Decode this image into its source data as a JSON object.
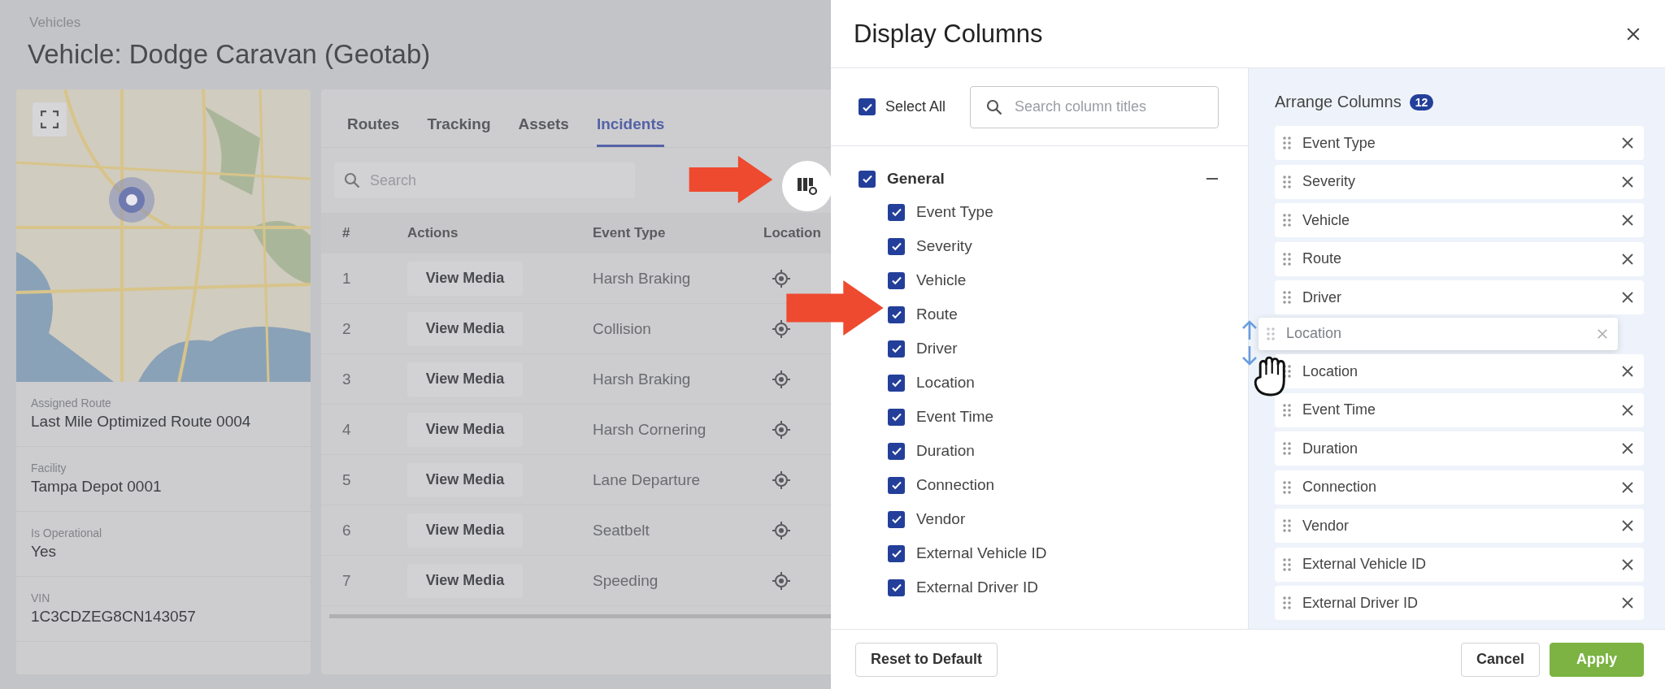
{
  "page": {
    "breadcrumb": "Vehicles",
    "title": "Vehicle: Dodge Caravan (Geotab)",
    "details": [
      {
        "label": "Assigned Route",
        "value": "Last Mile Optimized Route 0004"
      },
      {
        "label": "Facility",
        "value": "Tampa Depot 0001"
      },
      {
        "label": "Is Operational",
        "value": "Yes"
      },
      {
        "label": "VIN",
        "value": "1C3CDZEG8CN143057"
      }
    ],
    "tabs": [
      {
        "label": "Routes",
        "selected": false
      },
      {
        "label": "Tracking",
        "selected": false
      },
      {
        "label": "Assets",
        "selected": false
      },
      {
        "label": "Incidents",
        "selected": true
      }
    ],
    "search": {
      "placeholder": "Search"
    },
    "table": {
      "columns": [
        "#",
        "Actions",
        "Event Type",
        "Location"
      ],
      "rows": [
        {
          "number": "1",
          "action": "View Media",
          "event_type": "Harsh Braking"
        },
        {
          "number": "2",
          "action": "View Media",
          "event_type": "Collision"
        },
        {
          "number": "3",
          "action": "View Media",
          "event_type": "Harsh Braking"
        },
        {
          "number": "4",
          "action": "View Media",
          "event_type": "Harsh Cornering"
        },
        {
          "number": "5",
          "action": "View Media",
          "event_type": "Lane Departure"
        },
        {
          "number": "6",
          "action": "View Media",
          "event_type": "Seatbelt"
        },
        {
          "number": "7",
          "action": "View Media",
          "event_type": "Speeding"
        }
      ]
    }
  },
  "modal": {
    "title": "Display Columns",
    "select_all": {
      "label": "Select All",
      "checked": true
    },
    "search": {
      "placeholder": "Search column titles"
    },
    "groups": [
      {
        "label": "General",
        "checked": true,
        "expanded": true,
        "children": [
          {
            "label": "Event Type",
            "checked": true
          },
          {
            "label": "Severity",
            "checked": true
          },
          {
            "label": "Vehicle",
            "checked": true
          },
          {
            "label": "Route",
            "checked": true
          },
          {
            "label": "Driver",
            "checked": true
          },
          {
            "label": "Location",
            "checked": true
          },
          {
            "label": "Event Time",
            "checked": true
          },
          {
            "label": "Duration",
            "checked": true
          },
          {
            "label": "Connection",
            "checked": true
          },
          {
            "label": "Vendor",
            "checked": true
          },
          {
            "label": "External Vehicle ID",
            "checked": true
          },
          {
            "label": "External Driver ID",
            "checked": true
          }
        ]
      }
    ],
    "arrange": {
      "title": "Arrange Columns",
      "count": "12",
      "items": [
        "Event Type",
        "Severity",
        "Vehicle",
        "Route",
        "Driver",
        "Location",
        "Event Time",
        "Duration",
        "Connection",
        "Vendor",
        "External Vehicle ID",
        "External Driver ID"
      ],
      "dragging": "Location"
    },
    "buttons": {
      "reset": "Reset to Default",
      "cancel": "Cancel",
      "apply": "Apply"
    }
  }
}
